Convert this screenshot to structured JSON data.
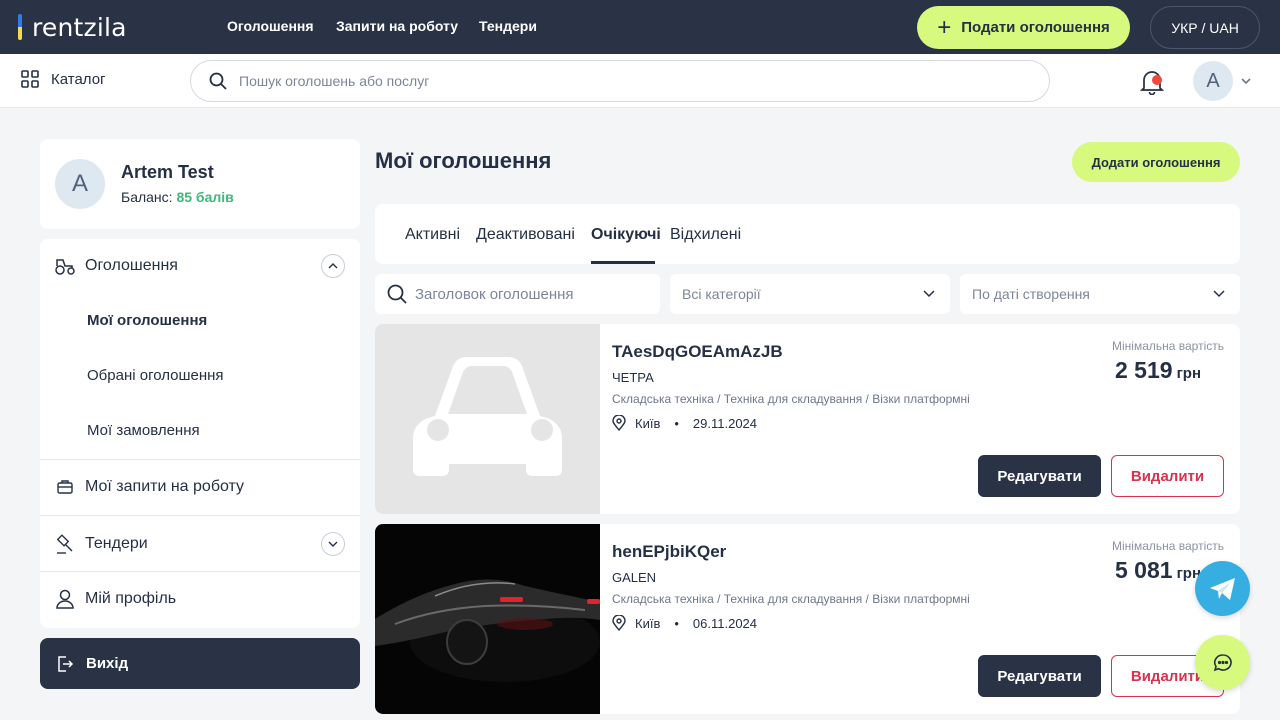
{
  "brand": {
    "logo_text": "rentzila"
  },
  "nav": {
    "items": [
      "Оголошення",
      "Запити на роботу",
      "Тендери"
    ]
  },
  "header": {
    "submit_label": "Подати оголошення",
    "lang_label": "УКР / UAH"
  },
  "searchbar": {
    "catalog_label": "Каталог",
    "placeholder": "Пошук оголошень або послуг",
    "avatar_initial": "A"
  },
  "profile": {
    "initial": "A",
    "name": "Artem Test",
    "balance_label": "Баланс:",
    "balance_value": "85 балів"
  },
  "sidebar": {
    "ads_label": "Оголошення",
    "sub_items": [
      "Мої оголошення",
      "Обрані оголошення",
      "Мої замовлення"
    ],
    "job_requests_label": "Мої запити на роботу",
    "tenders_label": "Тендери",
    "profile_label": "Мій профіль",
    "logout_label": "Вихід"
  },
  "main": {
    "title": "Мої оголошення",
    "add_button": "Додати оголошення",
    "tabs": [
      "Активні",
      "Деактивовані",
      "Очікуючі",
      "Відхилені"
    ],
    "active_tab": "Очікуючі",
    "filters": {
      "search_placeholder": "Заголовок оголошення",
      "category_value": "Всі категорії",
      "sort_value": "По даті створення"
    }
  },
  "listings": [
    {
      "title": "TAesDqGOEAmAzJB",
      "brand": "ЧЕТРА",
      "category": "Складська техніка / Техніка для складування / Візки платформні",
      "city": "Київ",
      "date": "29.11.2024",
      "price_label": "Мінімальна вартість",
      "price": "2 519",
      "currency": "грн",
      "edit_label": "Редагувати",
      "delete_label": "Видалити",
      "image": "placeholder-car"
    },
    {
      "title": "henEPjbiKQer",
      "brand": "GALEN",
      "category": "Складська техніка / Техніка для складування / Візки платформні",
      "city": "Київ",
      "date": "06.11.2024",
      "price_label": "Мінімальна вартість",
      "price": "5 081",
      "currency": "грн",
      "edit_label": "Редагувати",
      "delete_label": "Видалити",
      "image": "dark-sports-car-photo"
    }
  ],
  "colors": {
    "navy": "#2A3246",
    "accent_lime": "#D6F97E",
    "danger": "#D8334A",
    "balance_green": "#3FB87A",
    "telegram": "#37AEE2"
  }
}
